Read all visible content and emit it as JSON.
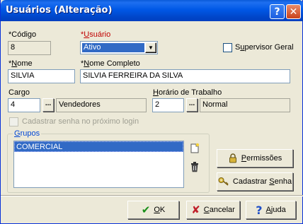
{
  "window": {
    "title": "Usuários (Alteração)",
    "help_glyph": "?",
    "close_glyph": "✕"
  },
  "fields": {
    "codigo": {
      "label": "*Código",
      "value": "8"
    },
    "usuario": {
      "label": "*Usuário",
      "value": "Ativo"
    },
    "supervisor": {
      "label": "Supervisor Geral",
      "checked": false
    },
    "nome": {
      "label": "*Nome",
      "value": "SILVIA"
    },
    "nome_completo": {
      "label": "*Nome Completo",
      "value": "SILVIA FERREIRA DA SILVA"
    },
    "cargo": {
      "label": "Cargo",
      "code": "4",
      "description": "Vendedores",
      "browse": "..."
    },
    "horario": {
      "label": "Horário de Trabalho",
      "code": "2",
      "description": "Normal",
      "browse": "..."
    },
    "cadastrar_senha": {
      "label": "Cadastrar senha no próximo login",
      "checked": false,
      "enabled": false
    }
  },
  "grupos": {
    "label": "Grupos",
    "items": [
      "COMERCIAL"
    ]
  },
  "buttons": {
    "permissoes": "Permissões",
    "cadastrar_senha": "Cadastrar Senha",
    "ok": "OK",
    "cancelar": "Cancelar",
    "ajuda": "Ajuda"
  },
  "icons": {
    "new": "new-document-icon",
    "delete": "trash-icon",
    "lock": "lock-icon",
    "key": "key-icon",
    "ok": "check-icon",
    "cancel": "x-icon",
    "help": "question-icon"
  },
  "colors": {
    "titlebar": "#0058e6",
    "selection": "#316ac5",
    "required_label": "#c00000",
    "ok_check": "#1a8f1a",
    "cancel_x": "#c0202a",
    "help_q": "#1f4fc7"
  }
}
